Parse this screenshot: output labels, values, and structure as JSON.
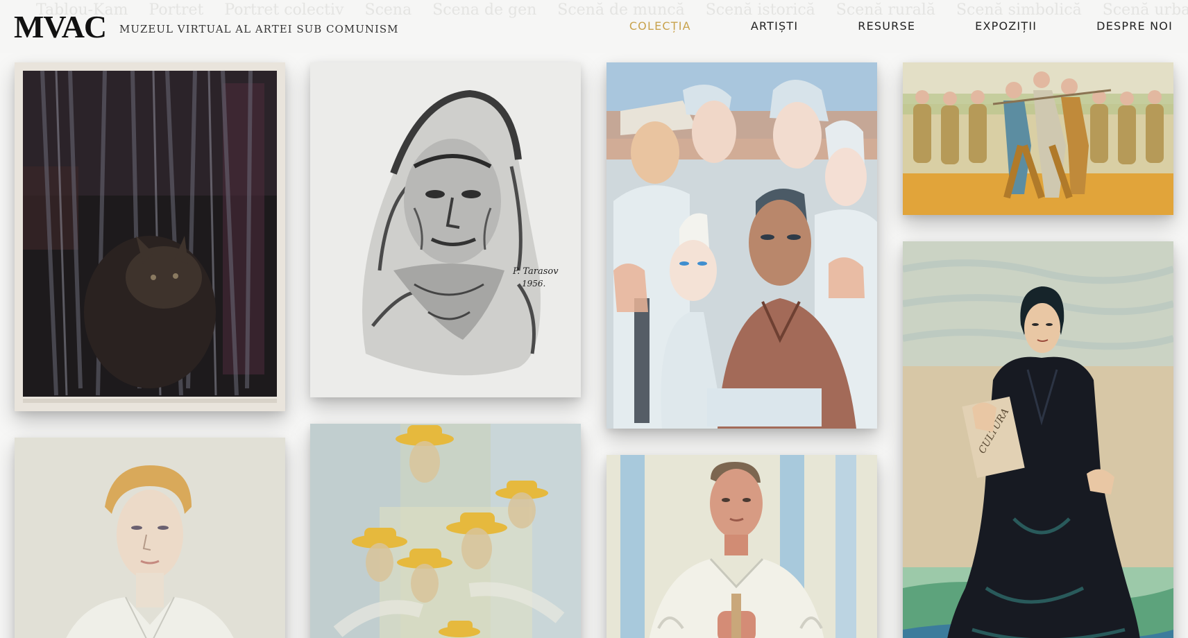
{
  "header": {
    "logo": "MVAC",
    "tagline": "MUZEUL VIRTUAL AL ARTEI SUB COMUNISM",
    "filters": [
      "Tablou-Kam",
      "Portret",
      "Portret colectiv",
      "Scena",
      "Scena de gen",
      "Scenă de muncă",
      "Scenă istorică",
      "Scenă rurală",
      "Scenă simbolică",
      "Scenă urbană"
    ],
    "nav": [
      {
        "label": "COLECȚIA",
        "active": true
      },
      {
        "label": "ARTIȘTI",
        "active": false
      },
      {
        "label": "RESURSE",
        "active": false
      },
      {
        "label": "EXPOZIȚII",
        "active": false
      },
      {
        "label": "DESPRE NOI",
        "active": false
      }
    ]
  },
  "artworks": [
    {
      "subject": "dark-animal-behind-curtain"
    },
    {
      "subject": "charcoal-portrait-old-woman-headscarf",
      "signature": "P. Tarasov",
      "year": "1956."
    },
    {
      "subject": "collective-portrait-workers"
    },
    {
      "subject": "procession-of-workers"
    },
    {
      "subject": "portrait-woman-light-dress"
    },
    {
      "subject": "men-in-yellow-hats"
    },
    {
      "subject": "portrait-worker-white-shirt"
    },
    {
      "subject": "seated-woman-black-dress",
      "book_text": "CULTURA"
    }
  ],
  "colors": {
    "accent": "#c8a24c",
    "background": "#f7f7f6"
  }
}
